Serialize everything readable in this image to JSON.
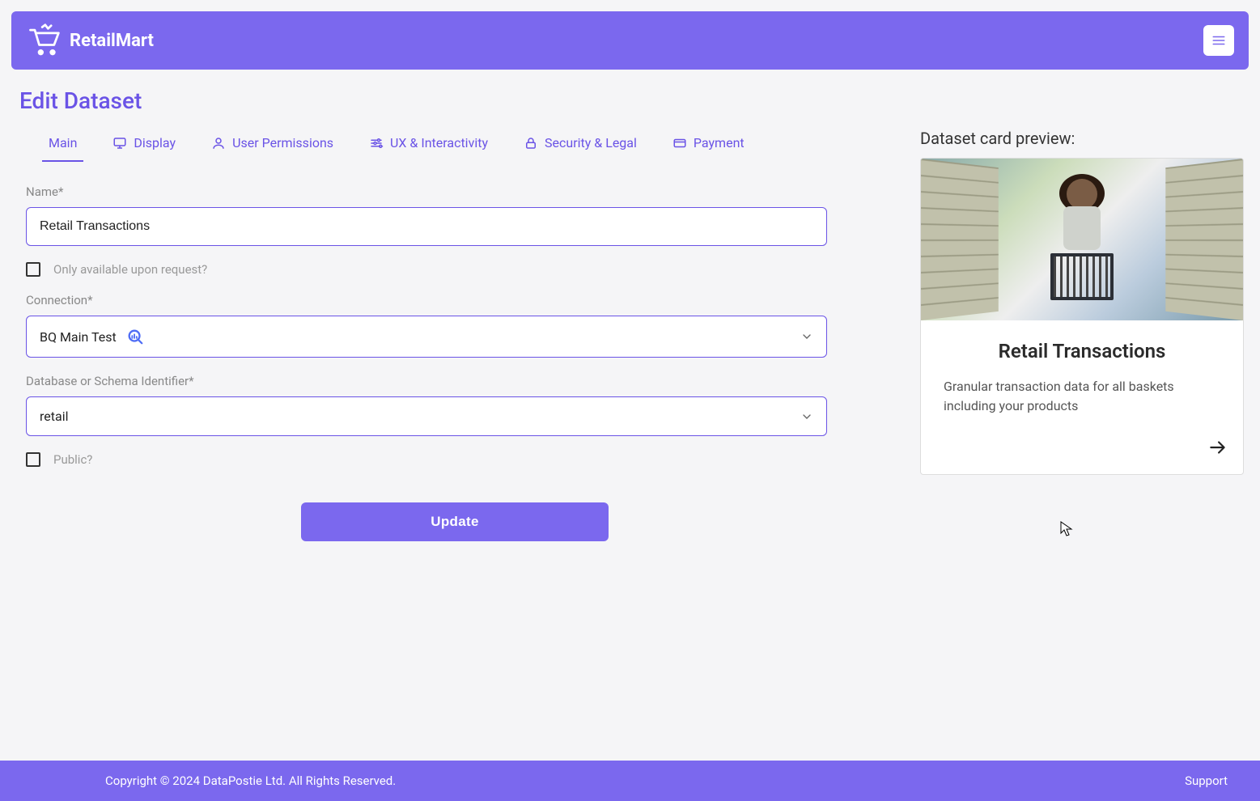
{
  "brand": {
    "name": "RetailMart"
  },
  "page_title": "Edit Dataset",
  "tabs": {
    "main": "Main",
    "display": "Display",
    "user_permissions": "User Permissions",
    "ux": "UX & Interactivity",
    "security": "Security & Legal",
    "payment": "Payment"
  },
  "form": {
    "name_label": "Name*",
    "name_value": "Retail Transactions",
    "request_only_label": "Only available upon request?",
    "connection_label": "Connection*",
    "connection_value": "BQ Main Test",
    "schema_label": "Database or Schema Identifier*",
    "schema_value": "retail",
    "public_label": "Public?",
    "update_button": "Update"
  },
  "preview": {
    "heading": "Dataset card preview:",
    "title": "Retail Transactions",
    "description": "Granular transaction data for all baskets including your products"
  },
  "footer": {
    "copyright": "Copyright © 2024 DataPostie Ltd. All Rights Reserved.",
    "support": "Support"
  }
}
